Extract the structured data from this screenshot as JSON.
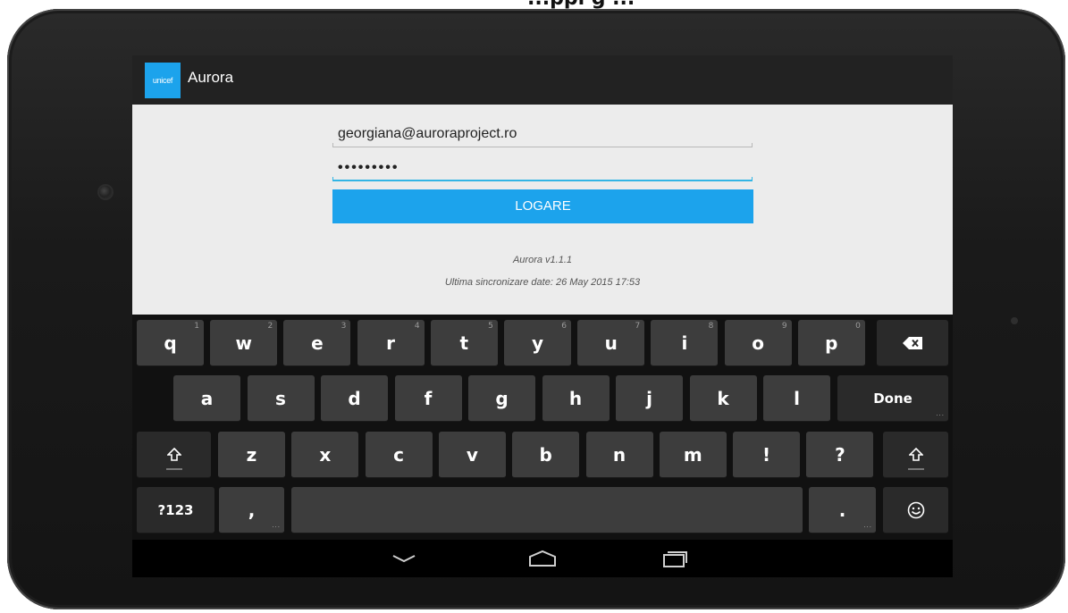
{
  "caption": "...ppi g ...",
  "app": {
    "logo_text": "unicef",
    "title": "Aurora"
  },
  "login": {
    "email_value": "georgiana@auroraproject.ro",
    "password_mask": "•••••••••",
    "button_label": "LOGARE",
    "version_text": "Aurora v1.1.1",
    "sync_text": "Ultima sincronizare date: 26 May 2015 17:53"
  },
  "keyboard": {
    "row1": [
      {
        "label": "q",
        "hint": "1"
      },
      {
        "label": "w",
        "hint": "2"
      },
      {
        "label": "e",
        "hint": "3"
      },
      {
        "label": "r",
        "hint": "4"
      },
      {
        "label": "t",
        "hint": "5"
      },
      {
        "label": "y",
        "hint": "6"
      },
      {
        "label": "u",
        "hint": "7"
      },
      {
        "label": "i",
        "hint": "8"
      },
      {
        "label": "o",
        "hint": "9"
      },
      {
        "label": "p",
        "hint": "0"
      }
    ],
    "row2": [
      "a",
      "s",
      "d",
      "f",
      "g",
      "h",
      "j",
      "k",
      "l"
    ],
    "row3": [
      "z",
      "x",
      "c",
      "v",
      "b",
      "n",
      "m",
      "!",
      "?"
    ],
    "done_label": "Done",
    "symbols_label": "?123",
    "comma_label": ",",
    "period_label": ".",
    "icons": {
      "backspace": "backspace-icon",
      "shift": "shift-icon",
      "emoji": "emoji-icon",
      "nav_back": "chevron-down-icon",
      "nav_home": "home-icon",
      "nav_recents": "recents-icon"
    }
  },
  "colors": {
    "accent": "#1ca3ec",
    "actionbar": "#222222",
    "content_bg": "#ececec",
    "keyboard_bg": "#111111",
    "key_bg": "#3d3d3d"
  }
}
